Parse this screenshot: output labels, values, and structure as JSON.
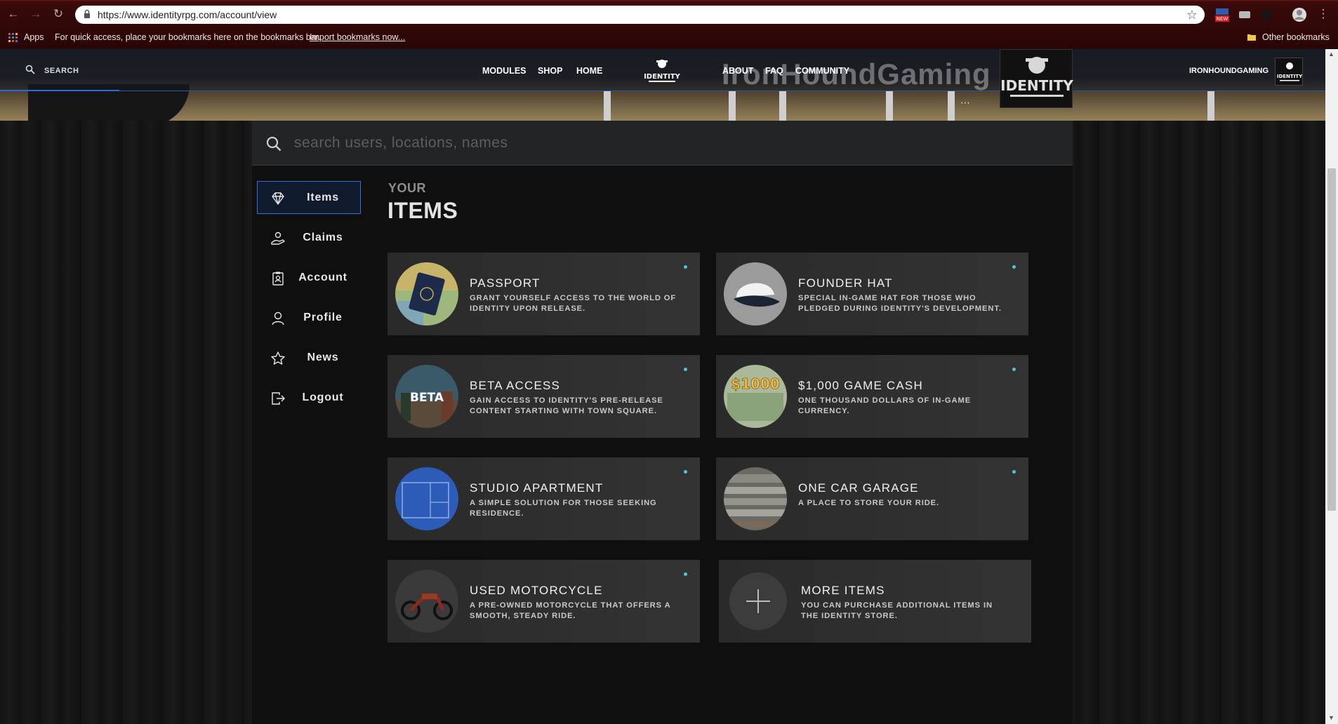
{
  "browser": {
    "url": "https://www.identityrpg.com/account/view",
    "apps_label": "Apps",
    "bookmarks_hint": "For quick access, place your bookmarks here on the bookmarks bar.",
    "import_link": "Import bookmarks now...",
    "other_bookmarks": "Other bookmarks",
    "ext_badge": "NEW"
  },
  "header": {
    "search_label": "SEARCH",
    "nav": [
      "MODULES",
      "SHOP",
      "HOME",
      "ABOUT",
      "FAQ",
      "COMMUNITY"
    ],
    "logo_text": "IDENTITY",
    "brand_watermark": "IronHoundGaming",
    "username": "IRONHOUNDGAMING"
  },
  "search": {
    "placeholder": "search users, locations, names"
  },
  "sidebar": {
    "items": [
      {
        "label": "Items",
        "icon": "diamond-icon",
        "active": true
      },
      {
        "label": "Claims",
        "icon": "hand-coin-icon"
      },
      {
        "label": "Account",
        "icon": "id-badge-icon"
      },
      {
        "label": "Profile",
        "icon": "user-icon"
      },
      {
        "label": "News",
        "icon": "star-icon"
      },
      {
        "label": "Logout",
        "icon": "logout-icon"
      }
    ]
  },
  "heading": {
    "kicker": "YOUR",
    "title": "ITEMS"
  },
  "items": [
    {
      "title": "PASSPORT",
      "desc": "GRANT YOURSELF ACCESS TO THE WORLD OF IDENTITY UPON RELEASE."
    },
    {
      "title": "FOUNDER HAT",
      "desc": "SPECIAL IN-GAME HAT FOR THOSE WHO PLEDGED DURING IDENTITY'S DEVELOPMENT."
    },
    {
      "title": "BETA ACCESS",
      "desc": "GAIN ACCESS TO IDENTITY'S PRE-RELEASE CONTENT STARTING WITH TOWN SQUARE.",
      "thumb_text": "BETA"
    },
    {
      "title": "$1,000 GAME CASH",
      "desc": "ONE THOUSAND DOLLARS OF IN-GAME CURRENCY.",
      "thumb_text": "$1000"
    },
    {
      "title": "STUDIO APARTMENT",
      "desc": "A SIMPLE SOLUTION FOR THOSE SEEKING RESIDENCE."
    },
    {
      "title": "ONE CAR GARAGE",
      "desc": "A PLACE TO STORE YOUR RIDE."
    },
    {
      "title": "USED MOTORCYCLE",
      "desc": "A PRE-OWNED MOTORCYCLE THAT OFFERS A SMOOTH, STEADY RIDE."
    }
  ],
  "more": {
    "title": "MORE ITEMS",
    "desc": "YOU CAN PURCHASE ADDITIONAL ITEMS IN THE IDENTITY STORE."
  },
  "colors": {
    "accent": "#3570d4",
    "dot": "#4fc6d8",
    "card": "#2e2e2e"
  }
}
